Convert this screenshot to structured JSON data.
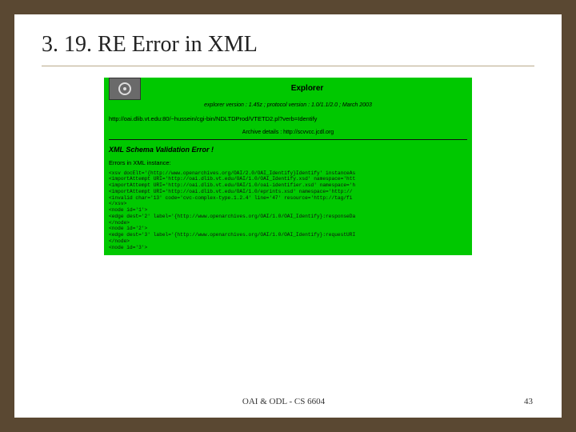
{
  "slide": {
    "title": "3. 19. RE Error in XML"
  },
  "screenshot": {
    "app_title": "Explorer",
    "version_line": "explorer version : 1.45z ; protocol version : 1.0/1.1/2.0 ; March 2003",
    "request_url": "http://oai.dlib.vt.edu:80/~hussein/cgi-bin/NDLTDProd/VTETD2.pl?verb=Identify",
    "archive_details_label": "Archive details : http://scvvcc.jcdl.org",
    "error_title": "XML Schema Validation Error !",
    "errors_label": "Errors in XML instance:",
    "code_lines": [
      "<xsv docElt='{http://www.openarchives.org/OAI/2.0/OAI_Identify}Identify' instanceAs",
      "<importAttempt URI='http://oai.dlib.vt.edu/OAI/1.0/OAI_Identify.xsd' namespace='htt",
      "<importAttempt URI='http://oai.dlib.vt.edu/OAI/1.0/oai-identifier.xsd' namespace='h",
      "<importAttempt URI='http://oai.dlib.vt.edu/OAI/1.0/eprints.xsd' namespace='http://",
      "<invalid char='13' code='cvc-complex-type.1.2.4' line='47' resource='http://tag/fi",
      "</xsv>",
      "<node id='1'>",
      "<edge dest='2' label='{http://www.openarchives.org/OAI/1.0/OAI_Identify}:responseDa",
      "</node>",
      "<node id='2'>",
      "<edge dest='3' label='{http://www.openarchives.org/OAI/1.0/OAI_Identify}:requestURI",
      "</node>",
      "<node id='3'>"
    ]
  },
  "footer": {
    "center": "OAI & ODL - CS 6604",
    "page": "43"
  }
}
